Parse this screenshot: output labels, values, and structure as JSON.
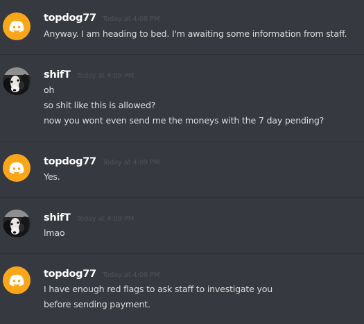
{
  "messages": [
    {
      "username": "topdog77",
      "timestamp": "Today at 4:08 PM",
      "avatar": "discord-logo-icon",
      "lines": [
        "Anyway. I am heading to bed. I'm awaiting some information from staff."
      ]
    },
    {
      "username": "shifT",
      "timestamp": "Today at 4:09 PM",
      "avatar": "dog-photo-avatar",
      "lines": [
        "oh",
        "so shit like this is allowed?",
        "now you wont even send me the moneys with the 7 day pending?"
      ]
    },
    {
      "username": "topdog77",
      "timestamp": "Today at 4:09 PM",
      "avatar": "discord-logo-icon",
      "lines": [
        "Yes."
      ]
    },
    {
      "username": "shifT",
      "timestamp": "Today at 4:09 PM",
      "avatar": "dog-photo-avatar",
      "lines": [
        "lmao"
      ]
    },
    {
      "username": "topdog77",
      "timestamp": "Today at 4:09 PM",
      "avatar": "discord-logo-icon",
      "lines": [
        "I have enough red flags to ask staff to investigate you",
        "before sending payment."
      ]
    }
  ],
  "colors": {
    "background": "#36393f",
    "username": "#ffffff",
    "message_text": "#dcddde",
    "timestamp": "#4f5358",
    "discord_avatar": "#faa61a"
  }
}
